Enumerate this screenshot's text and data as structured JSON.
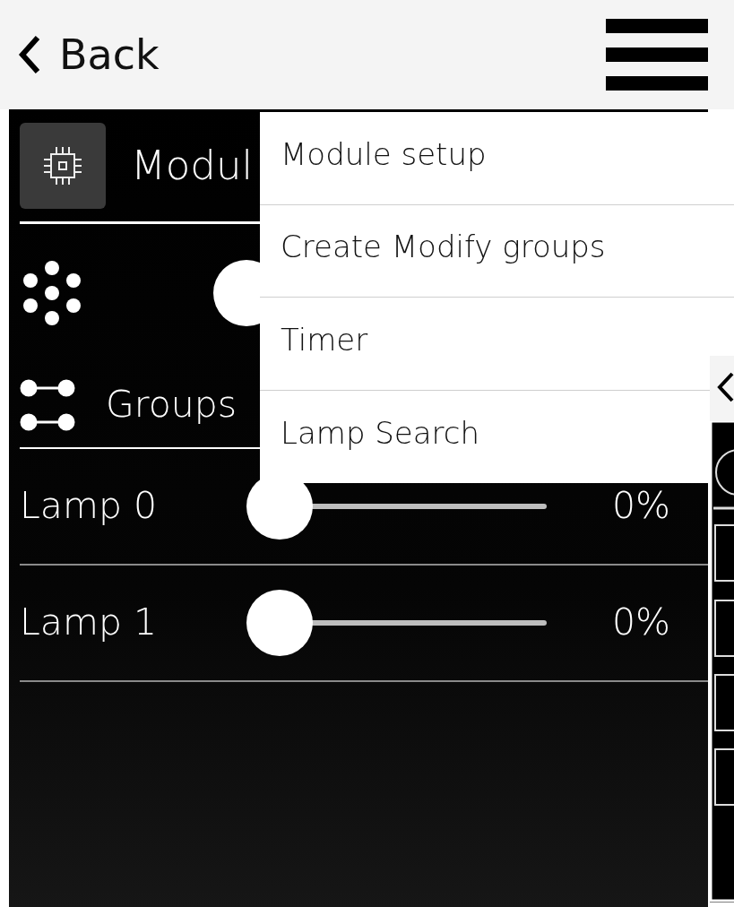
{
  "header": {
    "back_label": "Back"
  },
  "module": {
    "title": "Modul"
  },
  "master_slider": {
    "level": 0
  },
  "groups": {
    "label": "Groups"
  },
  "lamps": [
    {
      "name": "Lamp 0",
      "level": 0,
      "reading": "0%"
    },
    {
      "name": "Lamp 1",
      "level": 0,
      "reading": "0%"
    }
  ],
  "menu": {
    "items": [
      {
        "label": "Module setup"
      },
      {
        "label": "Create Modify groups"
      },
      {
        "label": "Timer"
      },
      {
        "label": "Lamp Search"
      }
    ]
  }
}
